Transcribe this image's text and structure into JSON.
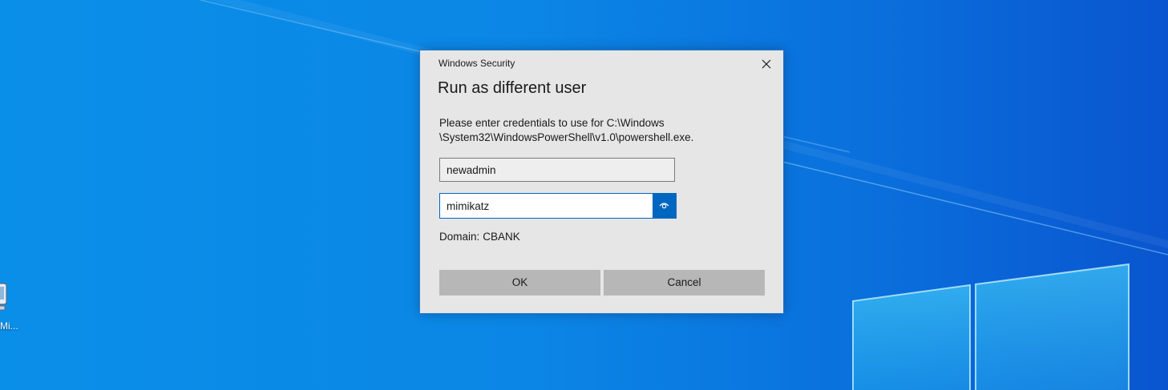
{
  "desktop": {
    "icon": {
      "name": "computer-icon",
      "label": "Mi..."
    }
  },
  "dialog": {
    "caption": "Windows Security",
    "title": "Run as different user",
    "message_line1": "Please enter credentials to use for C:\\Windows",
    "message_line2": "\\System32\\WindowsPowerShell\\v1.0\\powershell.exe.",
    "username_value": "newadmin",
    "password_value": "mimikatz",
    "domain_label": "Domain:",
    "domain_value": "CBANK",
    "ok_label": "OK",
    "cancel_label": "Cancel",
    "icons": {
      "close": "close-icon",
      "reveal": "eye-icon"
    },
    "colors": {
      "accent": "#0067c0",
      "background": "#e6e6e6",
      "button": "#b7b7b7"
    }
  }
}
